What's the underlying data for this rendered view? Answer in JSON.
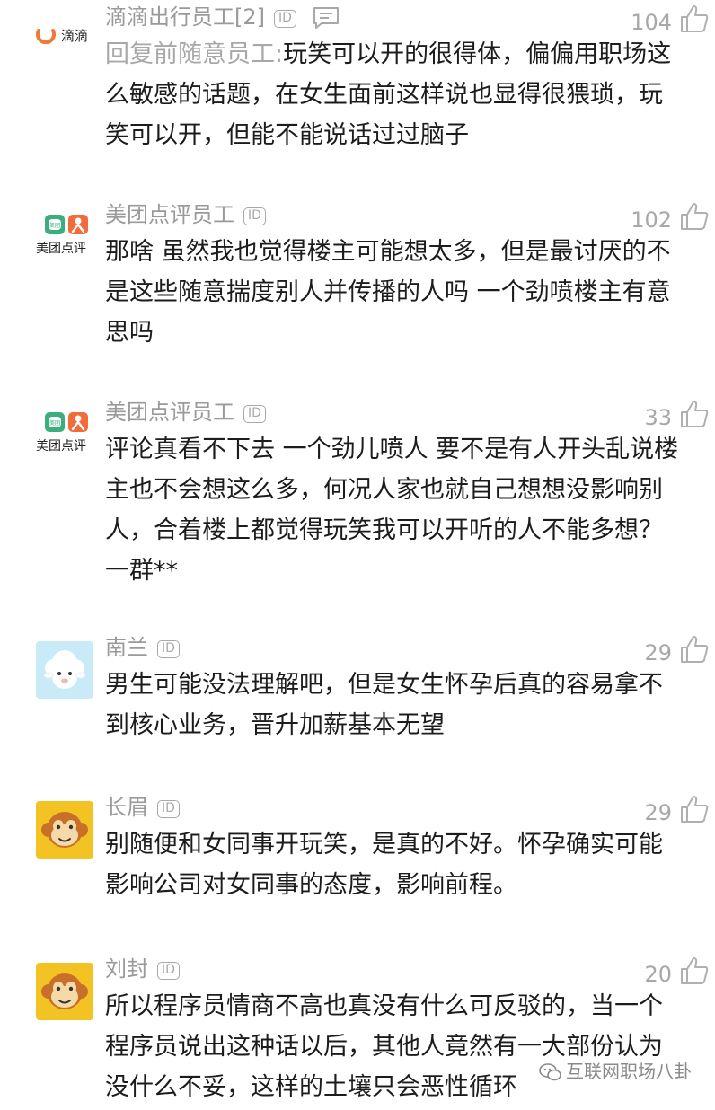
{
  "comments": [
    {
      "brand": "滴滴",
      "username": "滴滴出行员工[2]",
      "id_badge": "ID",
      "likes": "104",
      "reply_prefix": "回复前随意员工:",
      "text": "玩笑可以开的很得体，偏偏用职场这么敏感的话题，在女生面前这样说也显得很猥琐，玩笑可以开，但能不能说话过过脑子"
    },
    {
      "brand": "美团点评",
      "brand_badge": "美团",
      "username": "美团点评员工",
      "id_badge": "ID",
      "likes": "102",
      "text": "那啥 虽然我也觉得楼主可能想太多，但是最讨厌的不是这些随意揣度别人并传播的人吗 一个劲喷楼主有意思吗"
    },
    {
      "brand": "美团点评",
      "brand_badge": "美团",
      "username": "美团点评员工",
      "id_badge": "ID",
      "likes": "33",
      "text": "评论真看不下去 一个劲儿喷人 要不是有人开头乱说楼主也不会想这么多，何况人家也就自己想想没影响别人，合着楼上都觉得玩笑我可以开听的人不能多想？一群**"
    },
    {
      "username": "南兰",
      "id_badge": "ID",
      "likes": "29",
      "text": "男生可能没法理解吧，但是女生怀孕后真的容易拿不到核心业务，晋升加薪基本无望"
    },
    {
      "username": "长眉",
      "id_badge": "ID",
      "likes": "29",
      "text": "别随便和女同事开玩笑，是真的不好。怀孕确实可能影响公司对女同事的态度，影响前程。"
    },
    {
      "username": "刘封",
      "id_badge": "ID",
      "likes": "20",
      "text": "所以程序员情商不高也真没有什么可反驳的，当一个程序员说出这种话以后，其他人竟然有一大部份认为没什么不妥，这样的土壤只会恶性循环"
    }
  ],
  "watermark": "互联网职场八卦",
  "icons": {
    "like": "thumbs-up-icon",
    "message": "chat-bubble-icon",
    "didi": "didi-logo-icon",
    "meituan": "meituan-dianping-logo-icon",
    "sheep": "sheep-avatar-icon",
    "monkey": "monkey-avatar-icon"
  },
  "colors": {
    "muted": "#9a9a9a",
    "text": "#1c1c1c",
    "didi_orange": "#f27835",
    "meituan_green": "#3cae7e",
    "meituan_orange": "#f26b3a",
    "avatar_blue": "#c9eaf7",
    "avatar_yellow": "#f3c323"
  }
}
